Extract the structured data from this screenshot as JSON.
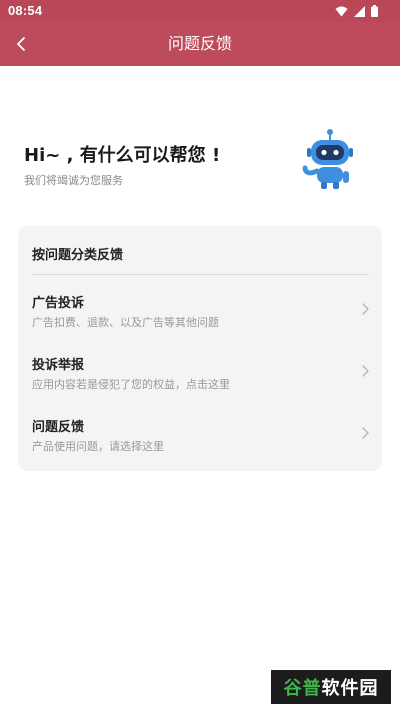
{
  "status_bar": {
    "time": "08:54"
  },
  "app_bar": {
    "title": "问题反馈"
  },
  "intro": {
    "greeting": "Hi~ , 有什么可以帮您 !",
    "subtitle": "我们将竭诚为您服务"
  },
  "card": {
    "header": "按问题分类反馈",
    "items": [
      {
        "title": "广告投诉",
        "subtitle": "广告扣费、退款、以及广告等其他问题"
      },
      {
        "title": "投诉举报",
        "subtitle": "应用内容若是侵犯了您的权益，点击这里"
      },
      {
        "title": "问题反馈",
        "subtitle": "产品使用问题，请选择这里"
      }
    ]
  },
  "watermark": {
    "part1": "谷普",
    "part2": "软件园"
  },
  "colors": {
    "app_bar": "#bd4b5c",
    "status_bar": "#b94758",
    "card_bg": "#f4f4f4",
    "robot": "#3f8fe0"
  }
}
